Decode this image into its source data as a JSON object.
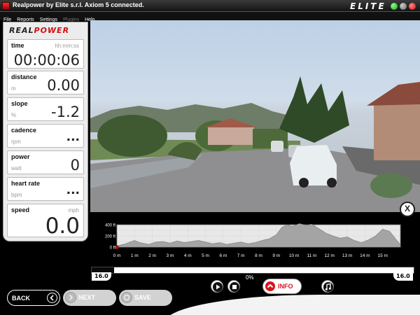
{
  "window": {
    "title": "Realpower by Elite s.r.l. Axiom 5 connected.",
    "brand": "ELITE"
  },
  "menu": [
    {
      "label": "File",
      "enabled": true
    },
    {
      "label": "Reports",
      "enabled": true
    },
    {
      "label": "Settings",
      "enabled": true
    },
    {
      "label": "Plugins",
      "enabled": false
    },
    {
      "label": "Help",
      "enabled": true
    }
  ],
  "panel": {
    "logo_black": "REAL",
    "logo_red": "POWER",
    "stats": {
      "time": {
        "label": "time",
        "unit": "hh:mm:ss",
        "value": "00:00:06"
      },
      "distance": {
        "label": "distance",
        "unit": "m",
        "value": "0.00"
      },
      "slope": {
        "label": "slope",
        "unit": "%",
        "value": "-1.2"
      },
      "cadence": {
        "label": "cadence",
        "unit": "rpm",
        "value": "..."
      },
      "power": {
        "label": "power",
        "unit": "watt",
        "value": "0"
      },
      "heart_rate": {
        "label": "heart rate",
        "unit": "bpm",
        "value": "..."
      },
      "speed": {
        "label": "speed",
        "unit": "mph",
        "value": "0.0"
      }
    }
  },
  "video": {
    "close_label": "X"
  },
  "chart_data": {
    "type": "area",
    "y_ticks": [
      "400 ft",
      "200 ft",
      "0 ft"
    ],
    "ylim": [
      0,
      400
    ],
    "x_ticks": [
      "0 m",
      "1 m",
      "2 m",
      "3 m",
      "4 m",
      "5 m",
      "6 m",
      "7 m",
      "8 m",
      "9 m",
      "10 m",
      "11 m",
      "12 m",
      "13 m",
      "14 m",
      "15 m"
    ],
    "xlim": [
      0,
      16
    ],
    "grid": true,
    "x": [
      0,
      0.5,
      1,
      1.3,
      1.8,
      2.2,
      2.6,
      3,
      3.4,
      3.8,
      4.2,
      4.6,
      5,
      5.4,
      5.8,
      6.2,
      6.6,
      7,
      7.4,
      7.8,
      8.2,
      8.6,
      9,
      9.3,
      9.6,
      9.9,
      10.3,
      10.7,
      11,
      11.4,
      11.8,
      12.2,
      12.6,
      13,
      13.4,
      13.8,
      14.2,
      14.6,
      15,
      15.4,
      15.8,
      16
    ],
    "y": [
      20,
      60,
      120,
      80,
      50,
      90,
      100,
      70,
      110,
      80,
      100,
      120,
      90,
      60,
      80,
      50,
      70,
      90,
      60,
      80,
      120,
      150,
      220,
      350,
      400,
      370,
      420,
      390,
      410,
      330,
      250,
      200,
      160,
      180,
      120,
      80,
      130,
      200,
      320,
      280,
      120,
      40
    ],
    "marker": {
      "x": 0,
      "y": 0,
      "color": "#aa1111"
    },
    "fill_color": "#a4a4a4",
    "background": "#e8e8e8"
  },
  "progress": {
    "left_label": "16.0",
    "right_label": "16.0",
    "percent_label": "0%",
    "fraction": 0.07
  },
  "controls": {
    "info_label": "INFO"
  },
  "nav": {
    "back_label": "BACK",
    "next_label": "NEXT",
    "save_label": "SAVE"
  }
}
